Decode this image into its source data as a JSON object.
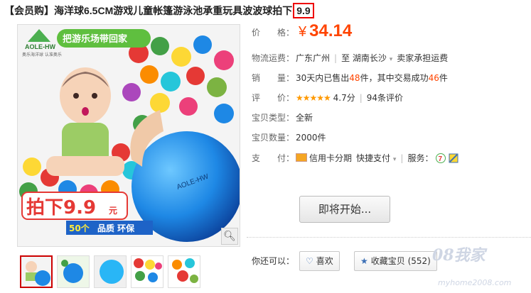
{
  "title": {
    "prefix": "【会员购】海洋球6.5CM游戏儿童帐篷游泳池承重玩具波波球拍下",
    "highlight": "9.9"
  },
  "image": {
    "logo": "AOLE-HW",
    "logo_sub": "奥乐海洋球 认准奥乐",
    "banner": "把游乐场带回家",
    "promo_main": "拍下9.9",
    "promo_unit": "元",
    "badge": "50个",
    "promo_tags": "品质 环保",
    "ball_brand": "AOLE-HW"
  },
  "price": {
    "label": "价　　格：",
    "currency": "¥",
    "value": "34.14"
  },
  "shipping": {
    "label": "物流运费：",
    "from": "广东广州",
    "to": "至 湖南长沙",
    "note": "卖家承担运费"
  },
  "sales": {
    "label": "销　　量：",
    "text1": "30天内已售出",
    "sold": "48",
    "text2": "件，其中交易成功",
    "success": "46",
    "text3": "件"
  },
  "rating": {
    "label": "评　　价：",
    "stars": "★★★★★",
    "score": "4.7分",
    "reviews": "94条评价"
  },
  "condition": {
    "label": "宝贝类型：",
    "value": "全新"
  },
  "stock": {
    "label": "宝贝数量：",
    "value": "2000件"
  },
  "payment": {
    "label": "支　　付：",
    "credit": "信用卡分期",
    "fast": "快捷支付",
    "service": "服务："
  },
  "buy_button": "即将开始...",
  "actions": {
    "label": "你还可以：",
    "like": "喜欢",
    "fav": "收藏宝贝 (552)"
  },
  "watermark": {
    "main": "08我家",
    "sub": "myhome2008.com"
  },
  "colors": {
    "accent": "#ff4400",
    "highlight_box": "#e00000",
    "link": "#3b6fb6",
    "star": "#ff9900"
  }
}
